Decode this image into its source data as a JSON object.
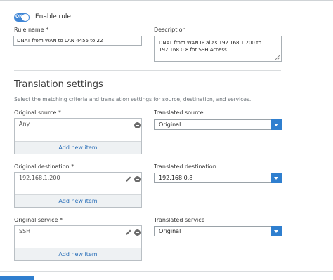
{
  "rule": {
    "toggle_state": "ON",
    "enable_label": "Enable rule",
    "name_label": "Rule name *",
    "name_value": "DNAT from WAN to LAN 4455 to 22",
    "description_label": "Description",
    "description_value": "DNAT from WAN IP alias 192.168.1.200 to 192.168.0.8 for SSH Access"
  },
  "translation": {
    "title": "Translation settings",
    "description": "Select the matching criteria and translation settings for source, destination, and services."
  },
  "source": {
    "original_label": "Original source *",
    "original_item": "Any",
    "add_label": "Add new item",
    "translated_label": "Translated source",
    "translated_value": "Original"
  },
  "destination": {
    "original_label": "Original destination *",
    "original_item": "192.168.1.200",
    "add_label": "Add new item",
    "translated_label": "Translated destination",
    "translated_value": "192.168.0.8"
  },
  "service": {
    "original_label": "Original service *",
    "original_item": "SSH",
    "add_label": "Add new item",
    "translated_label": "Translated service",
    "translated_value": "Original"
  },
  "colors": {
    "accent": "#2f7fcf",
    "link": "#2a6fb8",
    "toggle": "#3f86d6"
  },
  "icons": [
    "remove-icon",
    "edit-pencil-icon",
    "dropdown-caret-icon"
  ]
}
